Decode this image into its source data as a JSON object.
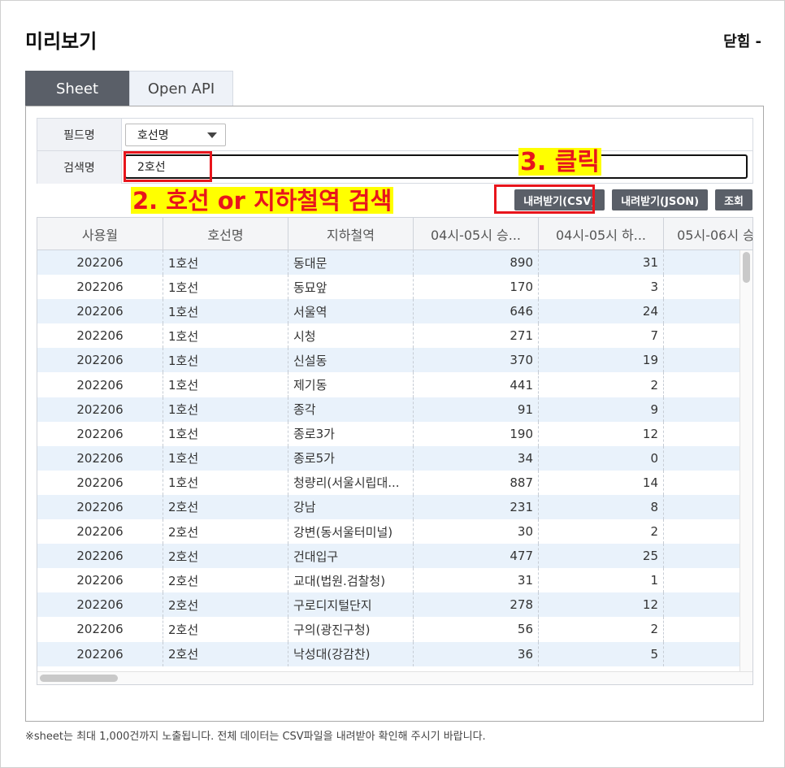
{
  "header": {
    "title": "미리보기",
    "close_label": "닫힘 -"
  },
  "tabs": [
    {
      "label": "Sheet",
      "active": true
    },
    {
      "label": "Open API",
      "active": false
    }
  ],
  "form": {
    "field_label": "필드명",
    "field_value": "호선명",
    "search_label": "검색명",
    "search_value": "2호선"
  },
  "annotations": {
    "step2": "2. 호선 or 지하철역 검색",
    "step3": "3. 클릭"
  },
  "buttons": {
    "csv": "내려받기(CSV)",
    "json": "내려받기(JSON)",
    "query": "조회"
  },
  "grid": {
    "columns": [
      "사용월",
      "호선명",
      "지하철역",
      "04시-05시 승...",
      "04시-05시 하...",
      "05시-06시 승"
    ],
    "rows": [
      [
        "202206",
        "1호선",
        "동대문",
        "890",
        "31"
      ],
      [
        "202206",
        "1호선",
        "동묘앞",
        "170",
        "3"
      ],
      [
        "202206",
        "1호선",
        "서울역",
        "646",
        "24"
      ],
      [
        "202206",
        "1호선",
        "시청",
        "271",
        "7"
      ],
      [
        "202206",
        "1호선",
        "신설동",
        "370",
        "19"
      ],
      [
        "202206",
        "1호선",
        "제기동",
        "441",
        "2"
      ],
      [
        "202206",
        "1호선",
        "종각",
        "91",
        "9"
      ],
      [
        "202206",
        "1호선",
        "종로3가",
        "190",
        "12"
      ],
      [
        "202206",
        "1호선",
        "종로5가",
        "34",
        "0"
      ],
      [
        "202206",
        "1호선",
        "청량리(서울시립대...",
        "887",
        "14"
      ],
      [
        "202206",
        "2호선",
        "강남",
        "231",
        "8"
      ],
      [
        "202206",
        "2호선",
        "강변(동서울터미널)",
        "30",
        "2"
      ],
      [
        "202206",
        "2호선",
        "건대입구",
        "477",
        "25"
      ],
      [
        "202206",
        "2호선",
        "교대(법원.검찰청)",
        "31",
        "1"
      ],
      [
        "202206",
        "2호선",
        "구로디지털단지",
        "278",
        "12"
      ],
      [
        "202206",
        "2호선",
        "구의(광진구청)",
        "56",
        "2"
      ],
      [
        "202206",
        "2호선",
        "낙성대(강감찬)",
        "36",
        "5"
      ]
    ]
  },
  "footnote": "※sheet는 최대 1,000건까지 노출됩니다. 전체 데이터는 CSV파일을 내려받아 확인해 주시기 바랍니다.",
  "colors": {
    "accent_dark": "#5a5f68",
    "highlight_red": "#e8151c",
    "highlight_yellow": "#ffff00",
    "row_blue": "#e9f2fb"
  }
}
